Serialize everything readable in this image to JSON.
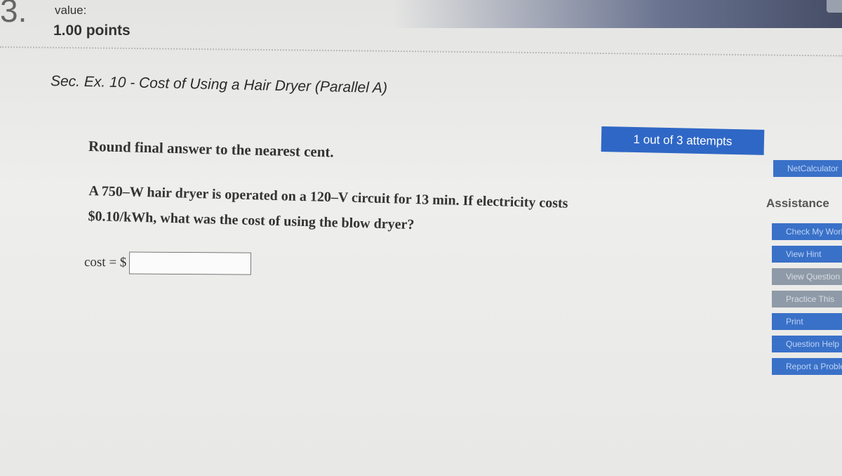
{
  "question": {
    "number": "3.",
    "value_label": "value:",
    "points": "1.00 points",
    "title": "Sec. Ex. 10 - Cost of Using a Hair Dryer (Parallel A)",
    "attempts": "1 out of 3 attempts",
    "instruction": "Round final answer to the nearest cent.",
    "problem_line1": "A 750–W hair dryer is operated on a 120–V circuit for 13 min. If electricity costs",
    "problem_line2": "$0.10/kWh, what was the cost of using the blow dryer?",
    "answer_label": "cost = $",
    "answer_value": ""
  },
  "sidebar": {
    "netcalc_label": "NetCalculator",
    "assistance_label": "Assistance",
    "buttons": [
      {
        "label": "Check My Work",
        "style": "blue"
      },
      {
        "label": "View Hint",
        "style": "blue"
      },
      {
        "label": "View Question",
        "style": "gray"
      },
      {
        "label": "Practice This",
        "style": "gray"
      },
      {
        "label": "Print",
        "style": "blue"
      },
      {
        "label": "Question Help",
        "style": "blue"
      },
      {
        "label": "Report a Problem",
        "style": "blue"
      }
    ]
  },
  "colors": {
    "accent_blue": "#2f67c6",
    "button_blue": "#3a71c8",
    "button_gray": "#8f9aa8"
  }
}
